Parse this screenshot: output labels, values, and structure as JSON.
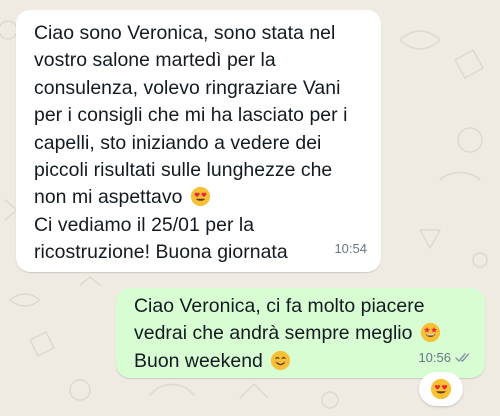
{
  "messages": [
    {
      "direction": "incoming",
      "text_main": "Ciao sono Veronica, sono stata nel\nvostro salone martedì per la\nconsulenza, volevo ringraziare Vani\nper i consigli che mi ha lasciato per i\ncapelli, sto iniziando a vedere dei\npiccoli risultati sulle lunghezze che\nnon mi aspettavo",
      "emoji_main": "heart-eyes",
      "text_tail": "Ci vediamo il 25/01 per la\nricostruzione! Buona giornata",
      "time": "10:54"
    },
    {
      "direction": "outgoing",
      "text_line1": "Ciao Veronica, ci fa molto piacere",
      "text_line2": "vedrai che andrà sempre meglio",
      "emoji_line2": "star-struck",
      "text_line3": "Buon weekend",
      "emoji_line3": "smiling",
      "time": "10:56",
      "status": "read",
      "reaction": "heart-eyes"
    }
  ],
  "colors": {
    "chat_background": "#efeae2",
    "incoming_bubble": "#ffffff",
    "outgoing_bubble": "#d9fdd3",
    "meta_text": "#667781",
    "read_ticks": "#8696a0"
  }
}
